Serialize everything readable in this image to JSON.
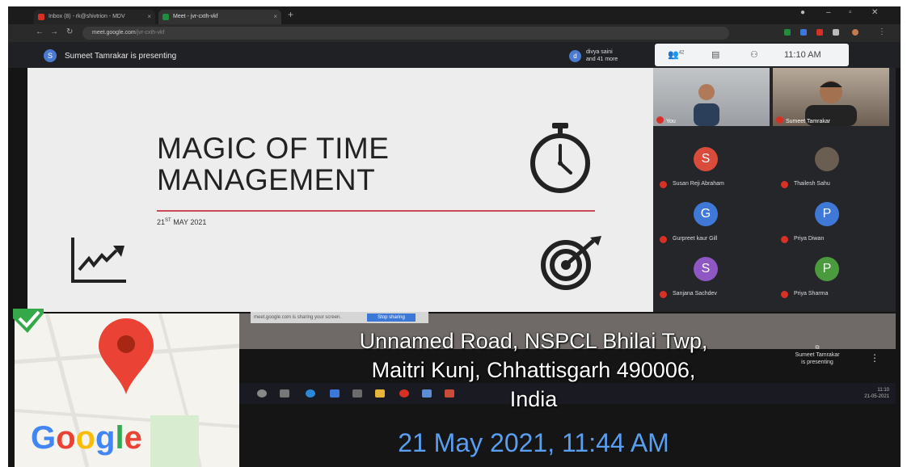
{
  "browser": {
    "tabs": [
      {
        "label": "Inbox (8) - rk@shivtrion - MDV",
        "close": "×"
      },
      {
        "label": "Meet - jvr-cxth-vkf",
        "close": "×"
      }
    ],
    "new_tab": "+",
    "url_host": "meet.google.com",
    "url_path": "/jvr-cxth-vkf"
  },
  "meet": {
    "presenter_avatar": "S",
    "presenter_text": "Sumeet Tamrakar is presenting",
    "viewer_avatar": "d",
    "viewer_text_line1": "divya saini",
    "viewer_text_line2": "and 41 more",
    "people_count": "42",
    "time": "11:10 AM",
    "video_tiles": [
      {
        "label": "You"
      },
      {
        "label": "Sumeet Tamrakar"
      }
    ],
    "participants": [
      {
        "initial": "S",
        "name": "Susan Reji Abraham",
        "color": "#d94b3b"
      },
      {
        "initial": "",
        "name": "Thailesh Sahu",
        "color": "#6a5d52"
      },
      {
        "initial": "G",
        "name": "Gurpreet kaur Gill",
        "color": "#3f78d6"
      },
      {
        "initial": "P",
        "name": "Priya Diwan",
        "color": "#3f78d6"
      },
      {
        "initial": "S",
        "name": "Sanjana Sachdev",
        "color": "#8e57c4"
      },
      {
        "initial": "P",
        "name": "Priya Sharma",
        "color": "#4c9a3e"
      }
    ],
    "share_infobar": "meet.google.com is sharing your screen.",
    "stop_sharing": "Stop sharing",
    "presenting_line1": "Sumeet Tamrakar",
    "presenting_line2": "is presenting",
    "taskbar_time_line1": "11:10",
    "taskbar_time_line2": "21-05-2021"
  },
  "slide": {
    "title_line1": "MAGIC OF TIME",
    "title_line2": "MANAGEMENT",
    "date_prefix": "21",
    "date_sup": "ST",
    "date_suffix": " MAY 2021"
  },
  "overlay": {
    "address_line1": "Unnamed Road, NSPCL Bhilai Twp,",
    "address_line2": "Maitri Kunj, Chhattisgarh 490006,",
    "address_line3": "India",
    "timestamp": "21 May 2021, 11:44 AM",
    "map_brand": [
      "G",
      "o",
      "o",
      "g",
      "l",
      "e"
    ],
    "brand_colors": [
      "#4285f4",
      "#ea4335",
      "#fbbc05",
      "#4285f4",
      "#34a853",
      "#ea4335"
    ]
  }
}
